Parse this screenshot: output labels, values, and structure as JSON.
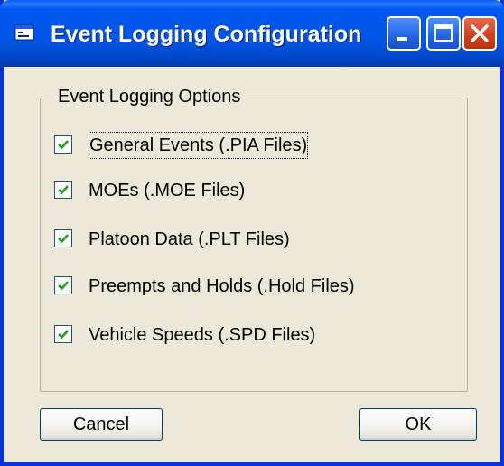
{
  "window": {
    "title": "Event Logging Configuration",
    "icon": "app-window-icon",
    "controls": [
      "minimize-icon",
      "maximize-icon",
      "close-icon"
    ]
  },
  "group": {
    "label": "Event Logging Options",
    "options": [
      {
        "label": "General Events (.PIA Files)",
        "checked": true,
        "focused": true
      },
      {
        "label": "MOEs  (.MOE Files)",
        "checked": true
      },
      {
        "label": "Platoon Data (.PLT Files)",
        "checked": true
      },
      {
        "label": "Preempts and Holds (.Hold Files)",
        "checked": true
      },
      {
        "label": "Vehicle Speeds (.SPD Files)",
        "checked": true
      }
    ]
  },
  "buttons": {
    "cancel": "Cancel",
    "ok": "OK"
  },
  "colors": {
    "titlebar": "#0055e6",
    "window_bg": "#ece9d8",
    "close_button": "#d13e1c"
  }
}
